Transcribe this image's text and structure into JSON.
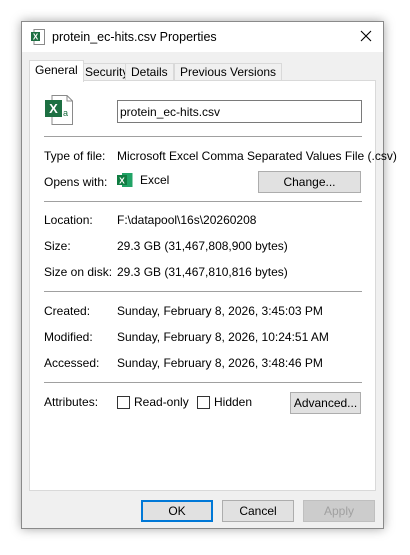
{
  "window": {
    "title": "protein_ec-hits.csv Properties"
  },
  "tabs": [
    {
      "label": "General"
    },
    {
      "label": "Security"
    },
    {
      "label": "Details"
    },
    {
      "label": "Previous Versions"
    }
  ],
  "general": {
    "file_name": "protein_ec-hits.csv",
    "type_label": "Type of file:",
    "type_value": "Microsoft Excel Comma Separated Values File (.csv)",
    "opens_label": "Opens with:",
    "opens_value": "Excel",
    "change_button": "Change...",
    "location_label": "Location:",
    "location_value": "F:\\datapool\\16s\\20260208",
    "size_label": "Size:",
    "size_value": "29.3 GB (31,467,808,900 bytes)",
    "size_on_disk_label": "Size on disk:",
    "size_on_disk_value": "29.3 GB (31,467,810,816 bytes)",
    "created_label": "Created:",
    "created_value": "Sunday, February 8, 2026, 3:45:03 PM",
    "modified_label": "Modified:",
    "modified_value": "Sunday, February 8, 2026, 10:24:51 AM",
    "accessed_label": "Accessed:",
    "accessed_value": "Sunday, February 8, 2026, 3:48:46 PM",
    "attributes_label": "Attributes:",
    "readonly_label": "Read-only",
    "readonly_checked": false,
    "hidden_label": "Hidden",
    "hidden_checked": false,
    "advanced_button": "Advanced..."
  },
  "footer": {
    "ok": "OK",
    "cancel": "Cancel",
    "apply": "Apply"
  },
  "icons": {
    "file": "excel-csv-file-icon",
    "app": "excel-app-icon",
    "close": "close-icon"
  },
  "colors": {
    "excel_green": "#1d6f42",
    "focus_blue": "#0078d7"
  }
}
